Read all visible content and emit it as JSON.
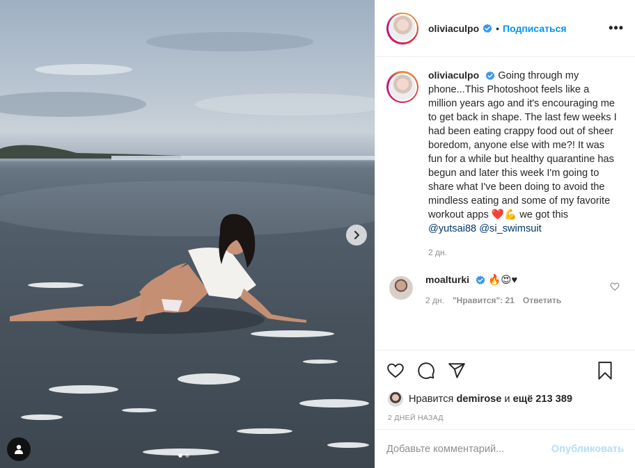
{
  "post": {
    "author": "oliviaculpo",
    "follow_label": "Подписаться",
    "bullet": "•",
    "more_label": "•••",
    "caption": "Going through my phone...This Photoshoot feels like a million years ago and it's encouraging me to get back in shape. The last few weeks I had been eating crappy food out of sheer boredom, anyone else with me?! It was fun for a while but healthy quarantine has begun and later this week I'm going to share what I've been doing to avoid the mindless eating and some of my favorite workout apps ❤️💪 we got this",
    "mention_1": "@yutsai88",
    "mention_2": "@si_swimsuit",
    "time_ago": "2 дн.",
    "carousel": {
      "slides": 2,
      "current": 1
    }
  },
  "comment": {
    "author": "moalturki",
    "text": "🔥😍♥",
    "time_ago": "2 дн.",
    "likes": "\"Нравится\": 21",
    "reply_label": "Ответить"
  },
  "likes_row": {
    "prefix": "Нравится",
    "liker": "demirose",
    "and": "и",
    "others": "ещё 213 389"
  },
  "date_label": "2 ДНЕЙ НАЗАД",
  "composer": {
    "placeholder": "Добавьте комментарий...",
    "publish_label": "Опубликовать"
  },
  "colors": {
    "accent": "#0095f6",
    "publish_disabled": "#b2dffc",
    "verified": "#3897f0",
    "muted": "#8e8e8e"
  },
  "icons": [
    "heart-icon",
    "comment-icon",
    "share-icon",
    "bookmark-icon",
    "next-arrow-icon",
    "tag-user-icon",
    "verified-icon",
    "more-icon"
  ]
}
